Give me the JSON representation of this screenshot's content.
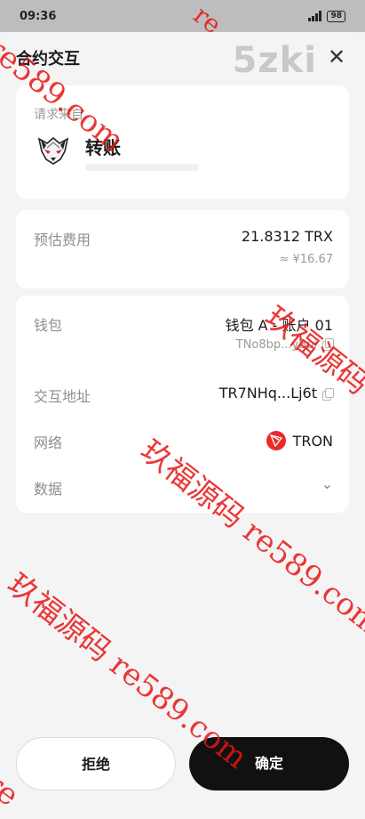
{
  "status_bar": {
    "time": "09:36",
    "battery": "98"
  },
  "header": {
    "title": "合约交互",
    "close": "✕",
    "watermark_brand": "5zki"
  },
  "request": {
    "label": "请求来自",
    "title": "转账"
  },
  "fee": {
    "label": "预估费用",
    "value": "21.8312 TRX",
    "fiat": "≈ ¥16.67"
  },
  "details": {
    "wallet_label": "钱包",
    "wallet_name": "钱包 A - 账户 01",
    "wallet_address": "TNo8bp...yBpi",
    "contract_label": "交互地址",
    "contract_address": "TR7NHq...Lj6t",
    "network_label": "网络",
    "network_name": "TRON",
    "data_label": "数据"
  },
  "actions": {
    "reject": "拒绝",
    "confirm": "确定"
  },
  "watermarks": [
    "re589.com",
    "玖福源码 re589.com",
    "玖福源码 re589.co",
    "玖福源码 re589.com",
    "玖福源码",
    "re"
  ],
  "colors": {
    "tron_red": "#ea2b2b",
    "confirm_bg": "#111111",
    "watermark": "#e61414"
  }
}
